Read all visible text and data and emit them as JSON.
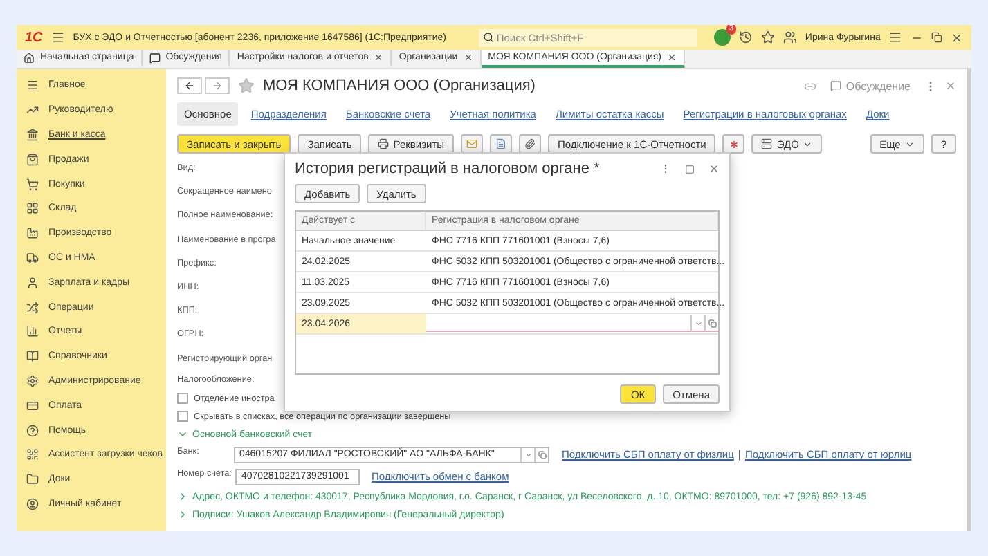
{
  "titlebar": {
    "logo": "1С",
    "title": "БУХ с ЭДО и Отчетностью [абонент 2236, приложение 1647586]  (1С:Предприятие)",
    "search": {
      "placeholder": "Поиск Ctrl+Shift+F"
    },
    "notification_badge": "3",
    "user": "Ирина Фурыгина"
  },
  "tabs": [
    {
      "label": "Начальная страница",
      "closable": false,
      "selected": false
    },
    {
      "label": "Обсуждения",
      "closable": false,
      "selected": false
    },
    {
      "label": "Настройки налогов и отчетов",
      "closable": true,
      "selected": false
    },
    {
      "label": "Организации",
      "closable": true,
      "selected": false
    },
    {
      "label": "МОЯ КОМПАНИЯ ООО (Организация)",
      "closable": true,
      "selected": true
    }
  ],
  "sidebar": {
    "items": [
      {
        "label": "Главное",
        "selected": false
      },
      {
        "label": "Руководителю",
        "selected": false
      },
      {
        "label": "Банк и касса",
        "selected": true
      },
      {
        "label": "Продажи",
        "selected": false
      },
      {
        "label": "Покупки",
        "selected": false
      },
      {
        "label": "Склад",
        "selected": false
      },
      {
        "label": "Производство",
        "selected": false
      },
      {
        "label": "ОС и НМА",
        "selected": false
      },
      {
        "label": "Зарплата и кадры",
        "selected": false
      },
      {
        "label": "Операции",
        "selected": false
      },
      {
        "label": "Отчеты",
        "selected": false
      },
      {
        "label": "Справочники",
        "selected": false
      },
      {
        "label": "Администрирование",
        "selected": false
      },
      {
        "label": "Оплата",
        "selected": false
      },
      {
        "label": "Помощь",
        "selected": false
      },
      {
        "label": "Ассистент загрузки чеков",
        "selected": false
      },
      {
        "label": "Доки",
        "selected": false
      },
      {
        "label": "Личный кабинет",
        "selected": false
      }
    ]
  },
  "form": {
    "title": "МОЯ КОМПАНИЯ ООО (Организация)",
    "discussion": "Обсуждение",
    "sections": [
      {
        "label": "Основное",
        "selected": true
      },
      {
        "label": "Подразделения",
        "selected": false
      },
      {
        "label": "Банковские счета",
        "selected": false
      },
      {
        "label": "Учетная политика",
        "selected": false
      },
      {
        "label": "Лимиты остатка кассы",
        "selected": false
      },
      {
        "label": "Регистрации в налоговых органах",
        "selected": false
      },
      {
        "label": "Доки",
        "selected": false
      }
    ],
    "toolbar": {
      "save_close": "Записать и закрыть",
      "save": "Записать",
      "requisites": "Реквизиты",
      "connect": "Подключение к 1С-Отчетности",
      "edo": "ЭДО",
      "more": "Еще",
      "help": "?"
    },
    "labels": [
      "Вид:",
      "Сокращенное наимено",
      "Полное наименование:",
      "Наименование в програ",
      "Префикс:",
      "ИНН:",
      "КПП:",
      "ОГРН:",
      "Регистрирующий орган",
      "Налогообложение:"
    ],
    "checkboxes": [
      {
        "label": "Отделение иностра",
        "checked": false
      },
      {
        "label": "Скрывать в списках, все операции по организации завершены",
        "checked": false
      }
    ],
    "bank_group": {
      "title": "Основной банковский счет",
      "expanded": true,
      "bank_label": "Банк:",
      "bank": "046015207 ФИЛИАЛ \"РОСТОВСКИЙ\" АО \"АЛЬФА-БАНК\"",
      "sbp_individuals": "Подключить СБП оплату от физлиц",
      "separator": "|",
      "sbp_companies": "Подключить СБП оплату от юрлиц",
      "account_label": "Номер счета:",
      "account": "40702810221739291001",
      "exchange_link": "Подключить обмен с банком"
    },
    "groups": [
      {
        "title": "Адрес, ОКТМО и телефон: 430017, Республика Мордовия, г.о. Саранск, г Саранск, ул Веселовского, д. 10, ОКТМО: 89701000, тел: +7 (926) 892-13-45",
        "expanded": false
      },
      {
        "title": "Подписи: Ушаков Александр Владимирович (Генеральный директор)",
        "expanded": false
      }
    ]
  },
  "dialog": {
    "title": "История регистраций в налоговом органе *",
    "add": "Добавить",
    "delete": "Удалить",
    "columns": [
      "Действует с",
      "Регистрация в налоговом органе"
    ],
    "rows": [
      {
        "date": "Начальное значение",
        "registration": "ФНС 7716 КПП 771601001 (Взносы 7,6)",
        "editing": false
      },
      {
        "date": "24.02.2025",
        "registration": "ФНС 5032 КПП 503201001 (Общество с ограниченной ответств...",
        "editing": false
      },
      {
        "date": "11.03.2025",
        "registration": "ФНС 7716 КПП 771601001 (Взносы 7,6)",
        "editing": false
      },
      {
        "date": "23.09.2025",
        "registration": "ФНС 5032 КПП 503201001 (Общество с ограниченной ответств...",
        "editing": false
      },
      {
        "date": "23.04.2026",
        "registration": "",
        "editing": true
      }
    ],
    "ok": "ОК",
    "cancel": "Отмена"
  }
}
